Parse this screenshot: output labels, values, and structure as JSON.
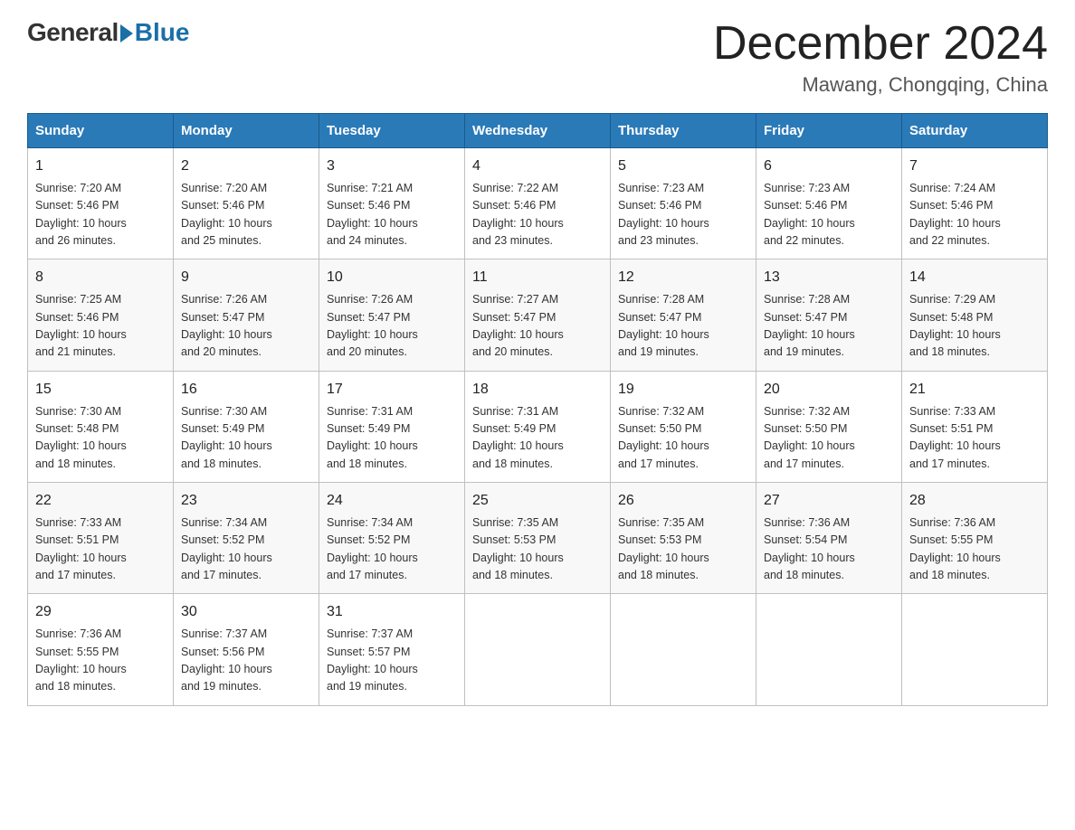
{
  "header": {
    "logo_general": "General",
    "logo_blue": "Blue",
    "title": "December 2024",
    "location": "Mawang, Chongqing, China"
  },
  "days_of_week": [
    "Sunday",
    "Monday",
    "Tuesday",
    "Wednesday",
    "Thursday",
    "Friday",
    "Saturday"
  ],
  "weeks": [
    [
      {
        "day": "1",
        "sunrise": "7:20 AM",
        "sunset": "5:46 PM",
        "daylight": "10 hours and 26 minutes."
      },
      {
        "day": "2",
        "sunrise": "7:20 AM",
        "sunset": "5:46 PM",
        "daylight": "10 hours and 25 minutes."
      },
      {
        "day": "3",
        "sunrise": "7:21 AM",
        "sunset": "5:46 PM",
        "daylight": "10 hours and 24 minutes."
      },
      {
        "day": "4",
        "sunrise": "7:22 AM",
        "sunset": "5:46 PM",
        "daylight": "10 hours and 23 minutes."
      },
      {
        "day": "5",
        "sunrise": "7:23 AM",
        "sunset": "5:46 PM",
        "daylight": "10 hours and 23 minutes."
      },
      {
        "day": "6",
        "sunrise": "7:23 AM",
        "sunset": "5:46 PM",
        "daylight": "10 hours and 22 minutes."
      },
      {
        "day": "7",
        "sunrise": "7:24 AM",
        "sunset": "5:46 PM",
        "daylight": "10 hours and 22 minutes."
      }
    ],
    [
      {
        "day": "8",
        "sunrise": "7:25 AM",
        "sunset": "5:46 PM",
        "daylight": "10 hours and 21 minutes."
      },
      {
        "day": "9",
        "sunrise": "7:26 AM",
        "sunset": "5:47 PM",
        "daylight": "10 hours and 20 minutes."
      },
      {
        "day": "10",
        "sunrise": "7:26 AM",
        "sunset": "5:47 PM",
        "daylight": "10 hours and 20 minutes."
      },
      {
        "day": "11",
        "sunrise": "7:27 AM",
        "sunset": "5:47 PM",
        "daylight": "10 hours and 20 minutes."
      },
      {
        "day": "12",
        "sunrise": "7:28 AM",
        "sunset": "5:47 PM",
        "daylight": "10 hours and 19 minutes."
      },
      {
        "day": "13",
        "sunrise": "7:28 AM",
        "sunset": "5:47 PM",
        "daylight": "10 hours and 19 minutes."
      },
      {
        "day": "14",
        "sunrise": "7:29 AM",
        "sunset": "5:48 PM",
        "daylight": "10 hours and 18 minutes."
      }
    ],
    [
      {
        "day": "15",
        "sunrise": "7:30 AM",
        "sunset": "5:48 PM",
        "daylight": "10 hours and 18 minutes."
      },
      {
        "day": "16",
        "sunrise": "7:30 AM",
        "sunset": "5:49 PM",
        "daylight": "10 hours and 18 minutes."
      },
      {
        "day": "17",
        "sunrise": "7:31 AM",
        "sunset": "5:49 PM",
        "daylight": "10 hours and 18 minutes."
      },
      {
        "day": "18",
        "sunrise": "7:31 AM",
        "sunset": "5:49 PM",
        "daylight": "10 hours and 18 minutes."
      },
      {
        "day": "19",
        "sunrise": "7:32 AM",
        "sunset": "5:50 PM",
        "daylight": "10 hours and 17 minutes."
      },
      {
        "day": "20",
        "sunrise": "7:32 AM",
        "sunset": "5:50 PM",
        "daylight": "10 hours and 17 minutes."
      },
      {
        "day": "21",
        "sunrise": "7:33 AM",
        "sunset": "5:51 PM",
        "daylight": "10 hours and 17 minutes."
      }
    ],
    [
      {
        "day": "22",
        "sunrise": "7:33 AM",
        "sunset": "5:51 PM",
        "daylight": "10 hours and 17 minutes."
      },
      {
        "day": "23",
        "sunrise": "7:34 AM",
        "sunset": "5:52 PM",
        "daylight": "10 hours and 17 minutes."
      },
      {
        "day": "24",
        "sunrise": "7:34 AM",
        "sunset": "5:52 PM",
        "daylight": "10 hours and 17 minutes."
      },
      {
        "day": "25",
        "sunrise": "7:35 AM",
        "sunset": "5:53 PM",
        "daylight": "10 hours and 18 minutes."
      },
      {
        "day": "26",
        "sunrise": "7:35 AM",
        "sunset": "5:53 PM",
        "daylight": "10 hours and 18 minutes."
      },
      {
        "day": "27",
        "sunrise": "7:36 AM",
        "sunset": "5:54 PM",
        "daylight": "10 hours and 18 minutes."
      },
      {
        "day": "28",
        "sunrise": "7:36 AM",
        "sunset": "5:55 PM",
        "daylight": "10 hours and 18 minutes."
      }
    ],
    [
      {
        "day": "29",
        "sunrise": "7:36 AM",
        "sunset": "5:55 PM",
        "daylight": "10 hours and 18 minutes."
      },
      {
        "day": "30",
        "sunrise": "7:37 AM",
        "sunset": "5:56 PM",
        "daylight": "10 hours and 19 minutes."
      },
      {
        "day": "31",
        "sunrise": "7:37 AM",
        "sunset": "5:57 PM",
        "daylight": "10 hours and 19 minutes."
      },
      null,
      null,
      null,
      null
    ]
  ],
  "labels": {
    "sunrise": "Sunrise:",
    "sunset": "Sunset:",
    "daylight": "Daylight:"
  }
}
